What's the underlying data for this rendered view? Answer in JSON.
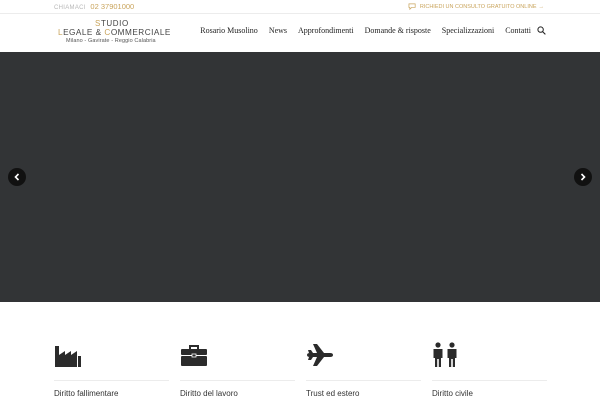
{
  "topbar": {
    "phone_label": "CHIAMACI",
    "phone_number": "02 37901000",
    "consult_link": "RICHIEDI UN CONSULTO GRATUITO ONLINE",
    "consult_arrow": "→"
  },
  "logo": {
    "line1_prefix": "S",
    "line1_rest": "TUDIO",
    "line2_a": "L",
    "line2_b": "EGALE & ",
    "line2_c": "C",
    "line2_d": "OMMERCIALE",
    "line3": "Milano - Gavirate - Reggio Calabria"
  },
  "nav": {
    "items": [
      "Rosario Musolino",
      "News",
      "Approfondimenti",
      "Domande & risposte",
      "Specializzazioni",
      "Contatti"
    ]
  },
  "services": [
    {
      "label": "Diritto fallimentare",
      "icon": "factory-icon"
    },
    {
      "label": "Diritto del lavoro",
      "icon": "briefcase-icon"
    },
    {
      "label": "Trust ed estero",
      "icon": "airplane-icon"
    },
    {
      "label": "Diritto civile",
      "icon": "people-icon"
    }
  ],
  "colors": {
    "accent": "#c9a45c",
    "hero_background": "#323436",
    "text": "#333333"
  }
}
